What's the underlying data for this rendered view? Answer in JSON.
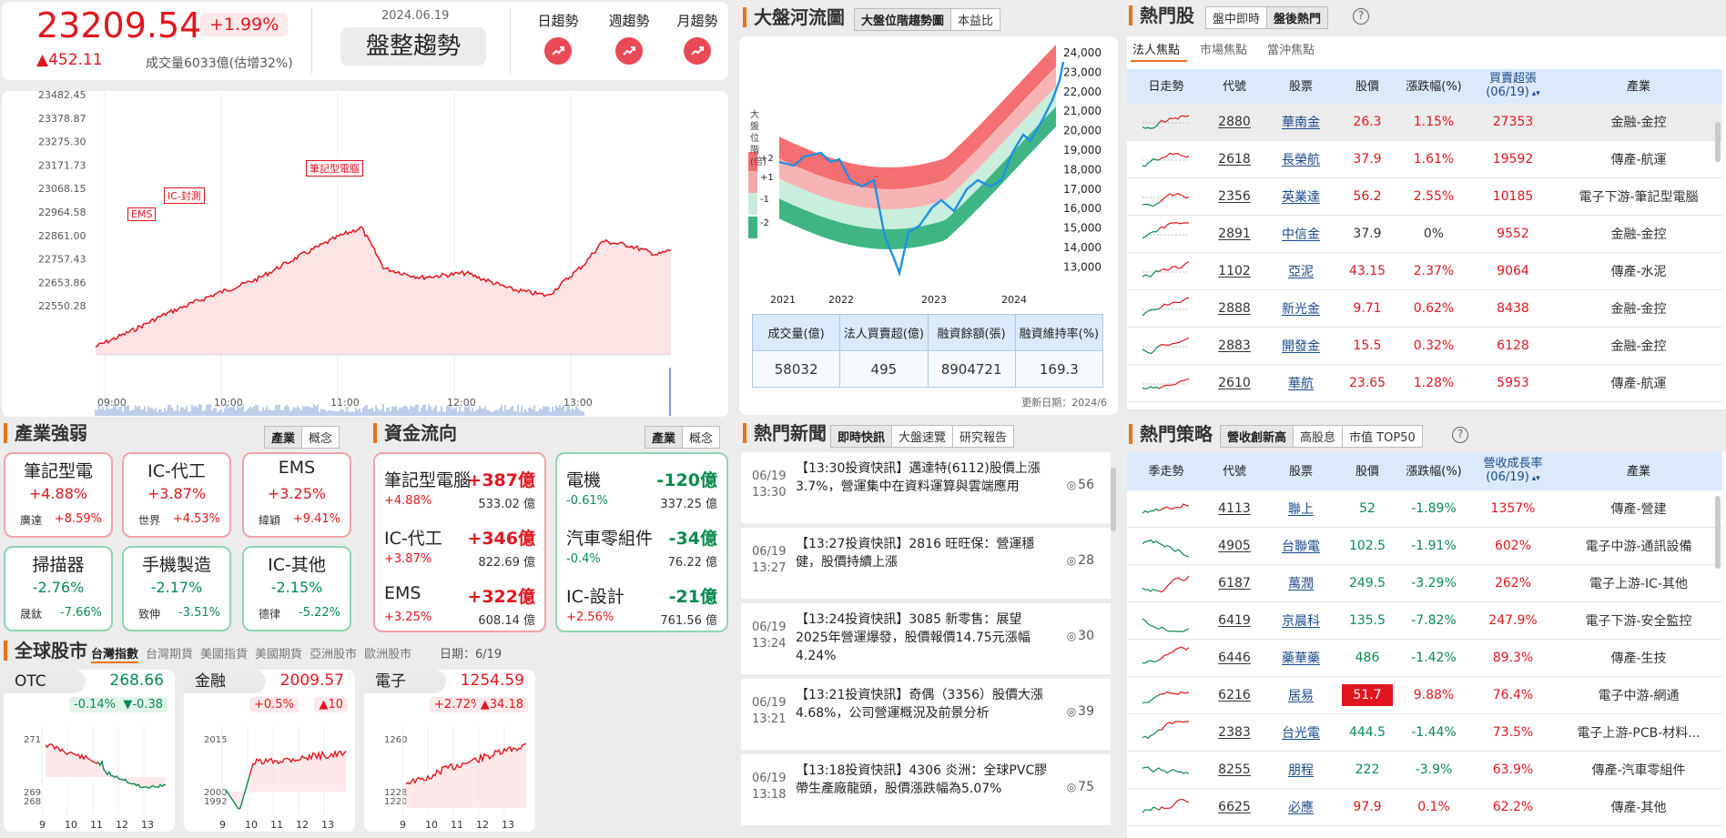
{
  "index": {
    "value": "23209.54",
    "pct": "+1.99%",
    "change": "▲452.11",
    "volume": "成交量6033億(估增32%)",
    "date": "2024.06.19",
    "trend": "盤整趨勢"
  },
  "trend_buttons": [
    {
      "label": "日趨勢"
    },
    {
      "label": "週趨勢"
    },
    {
      "label": "月趨勢"
    }
  ],
  "intraday": {
    "yticks": [
      "23482.45",
      "23378.87",
      "23275.30",
      "23171.73",
      "23068.15",
      "22964.58",
      "22861.00",
      "22757.43",
      "22653.86",
      "22550.28"
    ],
    "xticks": [
      "09:00",
      "10:00",
      "11:00",
      "12:00",
      "13:00"
    ],
    "annotations": [
      "EMS",
      "IC-封測",
      "筆記型電腦"
    ]
  },
  "river": {
    "title": "大盤河流圖",
    "tabs": [
      "大盤位階趨勢圖",
      "本益比"
    ],
    "yaxis_label": "大盤位階(倍)",
    "levels": [
      "+2",
      "+1",
      "-1",
      "-2"
    ],
    "yticks": [
      "24,000",
      "23,000",
      "22,000",
      "21,000",
      "20,000",
      "19,000",
      "18,000",
      "17,000",
      "16,000",
      "15,000",
      "14,000",
      "13,000"
    ],
    "xticks": [
      "2021",
      "2022",
      "2023",
      "2024"
    ],
    "stats_headers": [
      "成交量(億)",
      "法人買賣超(億)",
      "融資餘額(張)",
      "融資維持率(%)"
    ],
    "stats_values": [
      "58032",
      "495",
      "8904721",
      "169.3"
    ],
    "update": "更新日期：2024/6"
  },
  "hot": {
    "title": "熱門股",
    "tabs": [
      "盤中即時",
      "盤後熱門"
    ],
    "subtabs": [
      "法人焦點",
      "市場焦點",
      "當沖焦點"
    ],
    "headers": [
      "日走勢",
      "代號",
      "股票",
      "股價",
      "漲跌幅(%)",
      "買賣超張\n(06/19)",
      "產業"
    ],
    "rows": [
      {
        "code": "2880",
        "name": "華南金",
        "price": "26.3",
        "chg": "1.15%",
        "vol": "27353",
        "ind": "金融-金控",
        "c": "r"
      },
      {
        "code": "2618",
        "name": "長榮航",
        "price": "37.9",
        "chg": "1.61%",
        "vol": "19592",
        "ind": "傳產-航運",
        "c": "r"
      },
      {
        "code": "2356",
        "name": "英業達",
        "price": "56.2",
        "chg": "2.55%",
        "vol": "10185",
        "ind": "電子下游-筆記型電腦",
        "c": "r"
      },
      {
        "code": "2891",
        "name": "中信金",
        "price": "37.9",
        "chg": "0%",
        "vol": "9552",
        "ind": "金融-金控",
        "c": "n"
      },
      {
        "code": "1102",
        "name": "亞泥",
        "price": "43.15",
        "chg": "2.37%",
        "vol": "9064",
        "ind": "傳產-水泥",
        "c": "r"
      },
      {
        "code": "2888",
        "name": "新光金",
        "price": "9.71",
        "chg": "0.62%",
        "vol": "8438",
        "ind": "金融-金控",
        "c": "r"
      },
      {
        "code": "2883",
        "name": "開發金",
        "price": "15.5",
        "chg": "0.32%",
        "vol": "6128",
        "ind": "金融-金控",
        "c": "r"
      },
      {
        "code": "2610",
        "name": "華航",
        "price": "23.65",
        "chg": "1.28%",
        "vol": "5953",
        "ind": "傳產-航運",
        "c": "r"
      }
    ]
  },
  "industry": {
    "title": "產業強弱",
    "tabs": [
      "產業",
      "概念"
    ],
    "cards": [
      {
        "name": "筆記型電",
        "pct": "+4.88%",
        "sub": "廣達",
        "sub_pct": "+8.59%",
        "up": true
      },
      {
        "name": "IC-代工",
        "pct": "+3.87%",
        "sub": "世界",
        "sub_pct": "+4.53%",
        "up": true
      },
      {
        "name": "EMS",
        "pct": "+3.25%",
        "sub": "緯穎",
        "sub_pct": "+9.41%",
        "up": true
      },
      {
        "name": "掃描器",
        "pct": "-2.76%",
        "sub": "晟鈦",
        "sub_pct": "-7.66%",
        "up": false
      },
      {
        "name": "手機製造",
        "pct": "-2.17%",
        "sub": "致伸",
        "sub_pct": "-3.51%",
        "up": false
      },
      {
        "name": "IC-其他",
        "pct": "-2.15%",
        "sub": "德律",
        "sub_pct": "-5.22%",
        "up": false
      }
    ]
  },
  "flow": {
    "title": "資金流向",
    "tabs": [
      "產業",
      "概念"
    ],
    "inflow": [
      {
        "name": "筆記型電腦",
        "amt": "+387億",
        "pct": "+4.88%",
        "val": "533.02 億"
      },
      {
        "name": "IC-代工",
        "amt": "+346億",
        "pct": "+3.87%",
        "val": "822.69 億"
      },
      {
        "name": "EMS",
        "amt": "+322億",
        "pct": "+3.25%",
        "val": "608.14 億"
      }
    ],
    "outflow": [
      {
        "name": "電機",
        "amt": "-120億",
        "pct": "-0.61%",
        "val": "337.25 億"
      },
      {
        "name": "汽車零組件",
        "amt": "-34億",
        "pct": "-0.4%",
        "val": "76.22 億"
      },
      {
        "name": "IC-設計",
        "amt": "-21億",
        "pct": "+2.56%",
        "val": "761.56 億"
      }
    ]
  },
  "news": {
    "title": "熱門新聞",
    "tabs": [
      "即時快訊",
      "大盤速覽",
      "研究報告"
    ],
    "items": [
      {
        "date": "06/19",
        "time": "13:30",
        "text": "【13:30投資快訊】邁達特(6112)股價上漲3.7%，營運集中在資料運算與雲端應用",
        "views": "56"
      },
      {
        "date": "06/19",
        "time": "13:27",
        "text": "【13:27投資快訊】2816 旺旺保：營運穩健，股價持續上漲",
        "views": "28"
      },
      {
        "date": "06/19",
        "time": "13:24",
        "text": "【13:24投資快訊】3085 新零售：展望2025年營運爆發，股價報價14.75元漲幅4.24%",
        "views": "30"
      },
      {
        "date": "06/19",
        "time": "13:21",
        "text": "【13:21投資快訊】奇偶（3356）股價大漲 4.68%，公司營運概況及前景分析",
        "views": "39"
      },
      {
        "date": "06/19",
        "time": "13:18",
        "text": "【13:18投資快訊】4306 炎洲：全球PVC膠帶生產廠龍頭，股價漲跌幅為5.07%",
        "views": "75"
      }
    ]
  },
  "strategy": {
    "title": "熱門策略",
    "tabs": [
      "營收創新高",
      "高股息",
      "市值 TOP50"
    ],
    "headers": [
      "季走勢",
      "代號",
      "股票",
      "股價",
      "漲跌幅(%)",
      "營收成長率\n(06/19)",
      "產業"
    ],
    "rows": [
      {
        "code": "4113",
        "name": "聯上",
        "price": "52",
        "chg": "-1.89%",
        "growth": "1357%",
        "ind": "傳產-營建",
        "c": "g"
      },
      {
        "code": "4905",
        "name": "台聯電",
        "price": "102.5",
        "chg": "-1.91%",
        "growth": "602%",
        "ind": "電子中游-通訊設備",
        "c": "g"
      },
      {
        "code": "6187",
        "name": "萬潤",
        "price": "249.5",
        "chg": "-3.29%",
        "growth": "262%",
        "ind": "電子上游-IC-其他",
        "c": "g"
      },
      {
        "code": "6419",
        "name": "京晨科",
        "price": "135.5",
        "chg": "-7.82%",
        "growth": "247.9%",
        "ind": "電子下游-安全監控",
        "c": "g"
      },
      {
        "code": "6446",
        "name": "藥華藥",
        "price": "486",
        "chg": "-1.42%",
        "growth": "89.3%",
        "ind": "傳產-生技",
        "c": "g"
      },
      {
        "code": "6216",
        "name": "居易",
        "price": "51.7",
        "chg": "9.88%",
        "growth": "76.4%",
        "ind": "電子中游-網通",
        "c": "limit"
      },
      {
        "code": "2383",
        "name": "台光電",
        "price": "444.5",
        "chg": "-1.44%",
        "growth": "73.5%",
        "ind": "電子上游-PCB-材料...",
        "c": "g"
      },
      {
        "code": "8255",
        "name": "朋程",
        "price": "222",
        "chg": "-3.9%",
        "growth": "63.9%",
        "ind": "傳產-汽車零組件",
        "c": "g"
      },
      {
        "code": "6625",
        "name": "必應",
        "price": "97.9",
        "chg": "0.1%",
        "growth": "62.2%",
        "ind": "傳產-其他",
        "c": "r"
      }
    ]
  },
  "global": {
    "title": "全球股市",
    "tabs": [
      "台灣指數",
      "台灣期貨",
      "美國指貨",
      "美國期貨",
      "亞洲股市",
      "歐洲股市"
    ],
    "date": "日期：6/19",
    "cards": [
      {
        "name": "OTC",
        "value": "268.66",
        "pct": "-0.14%",
        "chg": "▼-0.38",
        "up": false,
        "yticks": [
          "271",
          "269",
          "268"
        ],
        "xticks": [
          "9",
          "10",
          "11",
          "12",
          "13"
        ]
      },
      {
        "name": "金融",
        "value": "2009.57",
        "pct": "+0.5%",
        "chg": "▲10",
        "up": true,
        "yticks": [
          "2015",
          "2000",
          "1992"
        ],
        "xticks": [
          "9",
          "10",
          "11",
          "12",
          "13"
        ]
      },
      {
        "name": "電子",
        "value": "1254.59",
        "pct": "+2.72%",
        "chg": "▲34.18",
        "up": true,
        "yticks": [
          "1260",
          "1228",
          "1220"
        ],
        "xticks": [
          "9",
          "10",
          "11",
          "12",
          "13"
        ]
      }
    ]
  }
}
